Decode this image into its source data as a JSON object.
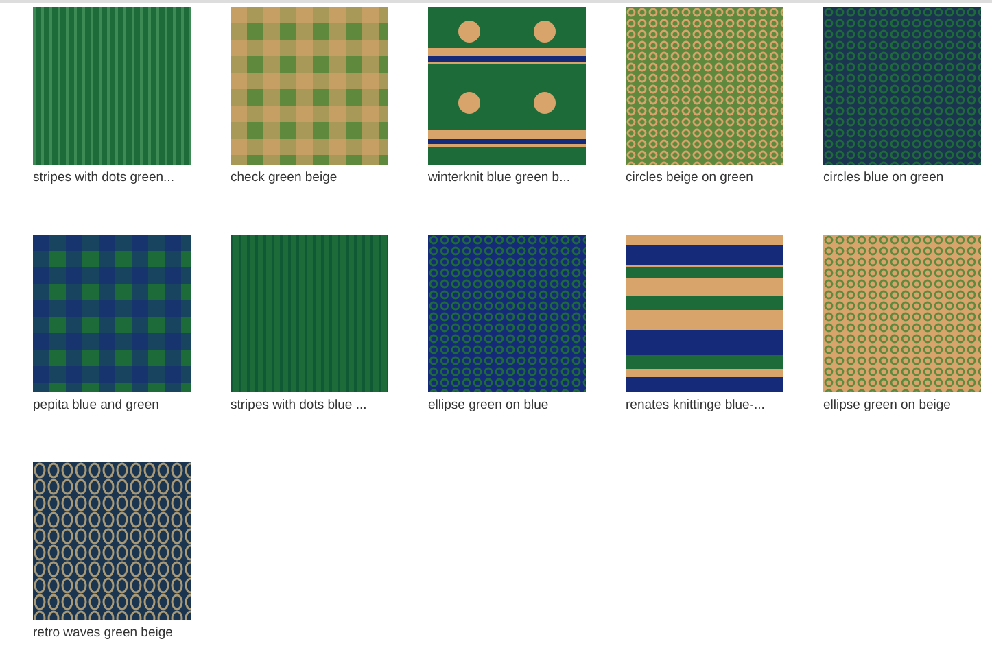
{
  "products": [
    {
      "kind": "picture",
      "label": "stripes with dots green..."
    },
    {
      "kind": "picture",
      "label": "check green beige"
    },
    {
      "kind": "picture",
      "label": "winterknit blue green b..."
    },
    {
      "kind": "picture",
      "label": "circles beige on green"
    },
    {
      "kind": "picture",
      "label": "circles blue on green"
    },
    {
      "kind": "picture",
      "label": "pepita blue and green"
    },
    {
      "kind": "picture",
      "label": "stripes with dots blue ..."
    },
    {
      "kind": "picture",
      "label": "ellipse green on blue"
    },
    {
      "kind": "picture",
      "label": "renates knittinge blue-..."
    },
    {
      "kind": "picture",
      "label": "ellipse green on beige"
    },
    {
      "kind": "picture",
      "label": "retro waves green beige"
    }
  ]
}
